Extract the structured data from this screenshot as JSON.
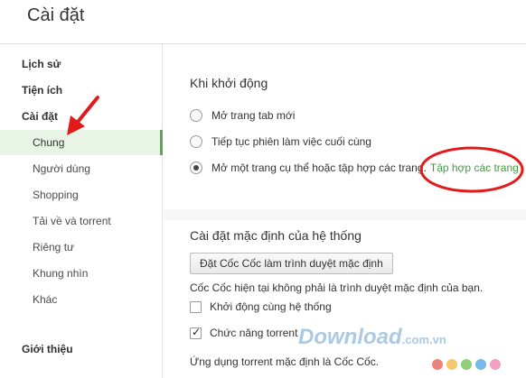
{
  "header": {
    "title": "Cài đặt"
  },
  "sidebar": {
    "headings": {
      "history": "Lịch sử",
      "extensions": "Tiện ích",
      "settings": "Cài đặt",
      "about": "Giới thiệu"
    },
    "items": [
      {
        "label": "Chung",
        "active": true
      },
      {
        "label": "Người dùng"
      },
      {
        "label": "Shopping"
      },
      {
        "label": "Tải về và torrent"
      },
      {
        "label": "Riêng tư"
      },
      {
        "label": "Khung nhìn"
      },
      {
        "label": "Khác"
      }
    ]
  },
  "startup": {
    "title": "Khi khởi động",
    "options": [
      {
        "label": "Mở trang tab mới",
        "checked": false
      },
      {
        "label": "Tiếp tục phiên làm việc cuối cùng",
        "checked": false
      },
      {
        "label": "Mở một trang cụ thể hoặc tập hợp các trang.",
        "checked": true
      }
    ],
    "link": "Tập hợp các trang"
  },
  "default_browser": {
    "title": "Cài đặt mặc định của hệ thống",
    "button": "Đặt Cốc Cốc làm trình duyệt mặc định",
    "status": "Cốc Cốc hiện tại không phải là trình duyệt mặc định của bạn.",
    "checkboxes": [
      {
        "label": "Khởi động cùng hệ thống",
        "checked": false
      },
      {
        "label": "Chức năng torrent",
        "checked": true
      }
    ],
    "note": "Ứng dụng torrent mặc định là Cốc Cốc."
  },
  "watermark": {
    "text": "Download",
    "suffix": ".com.vn"
  },
  "colors": {
    "accent_green": "#5aa84f",
    "link_green": "#3d9b3d",
    "annotation_red": "#e21a1a"
  }
}
